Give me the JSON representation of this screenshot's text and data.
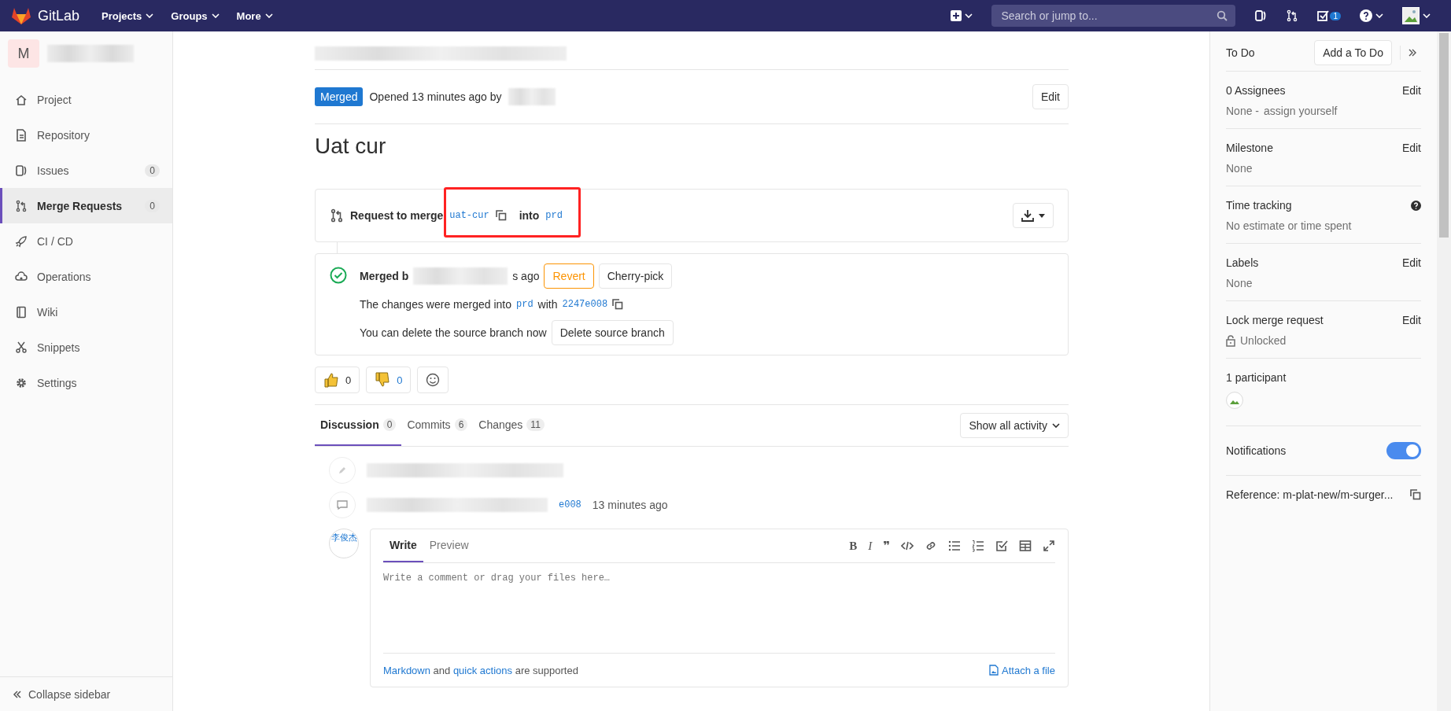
{
  "navbar": {
    "logo_text": "GitLab",
    "menus": [
      "Projects",
      "Groups",
      "More"
    ],
    "search": {
      "placeholder": "Search or jump to..."
    },
    "todo_count": "1"
  },
  "sidebar": {
    "project_initial": "M",
    "items": [
      {
        "label": "Project",
        "selected": false
      },
      {
        "label": "Repository",
        "selected": false
      },
      {
        "label": "Issues",
        "count": "0",
        "selected": false
      },
      {
        "label": "Merge Requests",
        "count": "0",
        "selected": true
      },
      {
        "label": "CI / CD",
        "selected": false
      },
      {
        "label": "Operations",
        "selected": false
      },
      {
        "label": "Wiki",
        "selected": false
      },
      {
        "label": "Snippets",
        "selected": false
      },
      {
        "label": "Settings",
        "selected": false
      }
    ],
    "collapse": "Collapse sidebar"
  },
  "header": {
    "status": "Merged",
    "opened": "Opened 13 minutes ago by",
    "edit": "Edit"
  },
  "title": "Uat cur",
  "request": {
    "prefix": "Request to merge",
    "source": "uat-cur",
    "into": "into",
    "target": "prd"
  },
  "merged": {
    "by_start": "Merged b",
    "by_end": "s ago",
    "revert": "Revert",
    "cherry_pick": "Cherry-pick",
    "changes_text": "The changes were merged into",
    "target": "prd",
    "with": "with",
    "commit": "2247e008",
    "delete_text": "You can delete the source branch now",
    "delete_button": "Delete source branch"
  },
  "awards": [
    {
      "kind": "thumbsup",
      "count": "0"
    },
    {
      "kind": "thumbsdown",
      "count": "0"
    },
    {
      "kind": "emoji"
    }
  ],
  "tabs": [
    {
      "label": "Discussion",
      "count": "0",
      "selected": true
    },
    {
      "label": "Commits",
      "count": "6",
      "selected": false
    },
    {
      "label": "Changes",
      "count": "11",
      "selected": false
    }
  ],
  "activity_filter": "Show all activity",
  "timeline": [
    {
      "kind": "system"
    },
    {
      "kind": "comment",
      "commit": "e008",
      "time": "13 minutes ago"
    }
  ],
  "avatar_alt": "李俊杰",
  "editor": {
    "tabs": [
      {
        "label": "Write",
        "selected": true
      },
      {
        "label": "Preview",
        "selected": false
      }
    ],
    "toolbar": [
      {
        "kind": "bold",
        "glyph": "B"
      },
      {
        "kind": "italic",
        "glyph": "I"
      },
      {
        "kind": "quote",
        "glyph": "❞"
      },
      {
        "kind": "code"
      },
      {
        "kind": "link"
      },
      {
        "kind": "bullets"
      },
      {
        "kind": "numbers"
      },
      {
        "kind": "task"
      },
      {
        "kind": "table"
      },
      {
        "kind": "fullscreen"
      }
    ],
    "placeholder": "Write a comment or drag your files here…",
    "footer": {
      "markdown": "Markdown",
      "and": "and",
      "quick": "quick actions",
      "supported": "are supported"
    },
    "attach": "Attach a file"
  },
  "rightbar": {
    "todo": "To Do",
    "add_todo": "Add a To Do",
    "blocks": [
      {
        "kind": "edit",
        "title": "0 Assignees",
        "action": "Edit",
        "value": "None -",
        "link": "assign yourself"
      },
      {
        "kind": "edit",
        "title": "Milestone",
        "action": "Edit",
        "value": "None"
      },
      {
        "kind": "help",
        "title": "Time tracking",
        "value": "No estimate or time spent"
      },
      {
        "kind": "edit",
        "title": "Labels",
        "action": "Edit",
        "value": "None"
      },
      {
        "kind": "lock",
        "title": "Lock merge request",
        "action": "Edit",
        "value": "Unlocked"
      },
      {
        "kind": "participants",
        "title": "1 participant"
      },
      {
        "kind": "toggle",
        "title": "Notifications",
        "on": true
      },
      {
        "kind": "reference",
        "title": "Reference: m-plat-new/m-surger..."
      }
    ]
  }
}
